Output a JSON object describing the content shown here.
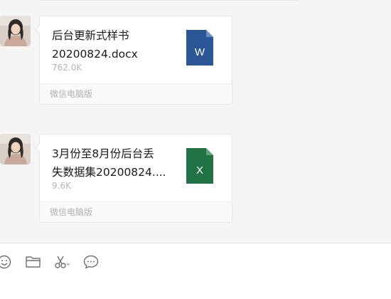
{
  "messages": [
    {
      "file_name": "后台更新式样书\n20200824.docx",
      "file_size": "762.0K",
      "file_type_letter": "W",
      "file_icon_color": "#2b5797",
      "source": "微信电脑版"
    },
    {
      "file_name": "3月份至8月份后台丢\n失数据集20200824....",
      "file_size": "9.6K",
      "file_type_letter": "X",
      "file_icon_color": "#217346",
      "source": "微信电脑版"
    }
  ],
  "toolbar": {
    "icons": [
      "emoji-icon",
      "folder-icon",
      "scissors-icon",
      "chat-bubble-icon"
    ]
  }
}
